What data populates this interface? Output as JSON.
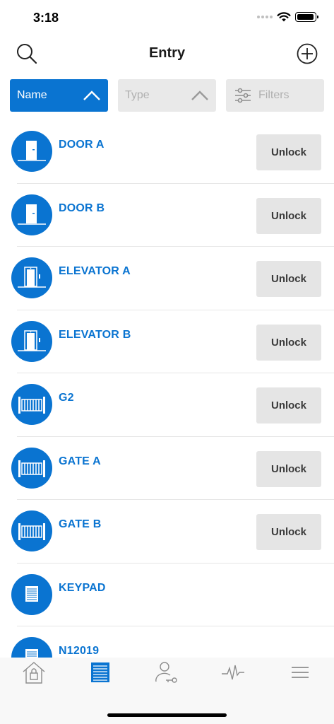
{
  "status_bar": {
    "time": "3:18"
  },
  "header": {
    "title": "Entry"
  },
  "sort_bar": {
    "name_label": "Name",
    "type_label": "Type",
    "filters_label": "Filters"
  },
  "colors": {
    "accent": "#0a74d1",
    "button_bg": "#e5e5e5",
    "divider": "#e6e6e6"
  },
  "entries": [
    {
      "name": "DOOR A",
      "icon": "door-icon",
      "action": "Unlock"
    },
    {
      "name": "DOOR B",
      "icon": "door-icon",
      "action": "Unlock"
    },
    {
      "name": "ELEVATOR A",
      "icon": "elevator-icon",
      "action": "Unlock"
    },
    {
      "name": "ELEVATOR B",
      "icon": "elevator-icon",
      "action": "Unlock"
    },
    {
      "name": "G2",
      "icon": "gate-icon",
      "action": "Unlock"
    },
    {
      "name": "GATE A",
      "icon": "gate-icon",
      "action": "Unlock"
    },
    {
      "name": "GATE B",
      "icon": "gate-icon",
      "action": "Unlock"
    },
    {
      "name": "KEYPAD",
      "icon": "keypad-icon",
      "action": ""
    },
    {
      "name": "N12019",
      "icon": "keypad-icon",
      "action": ""
    }
  ],
  "tab_bar": {
    "tabs": [
      {
        "name": "home-lock-icon",
        "active": false
      },
      {
        "name": "entry-icon",
        "active": true
      },
      {
        "name": "user-key-icon",
        "active": false
      },
      {
        "name": "activity-icon",
        "active": false
      },
      {
        "name": "menu-icon",
        "active": false
      }
    ]
  }
}
